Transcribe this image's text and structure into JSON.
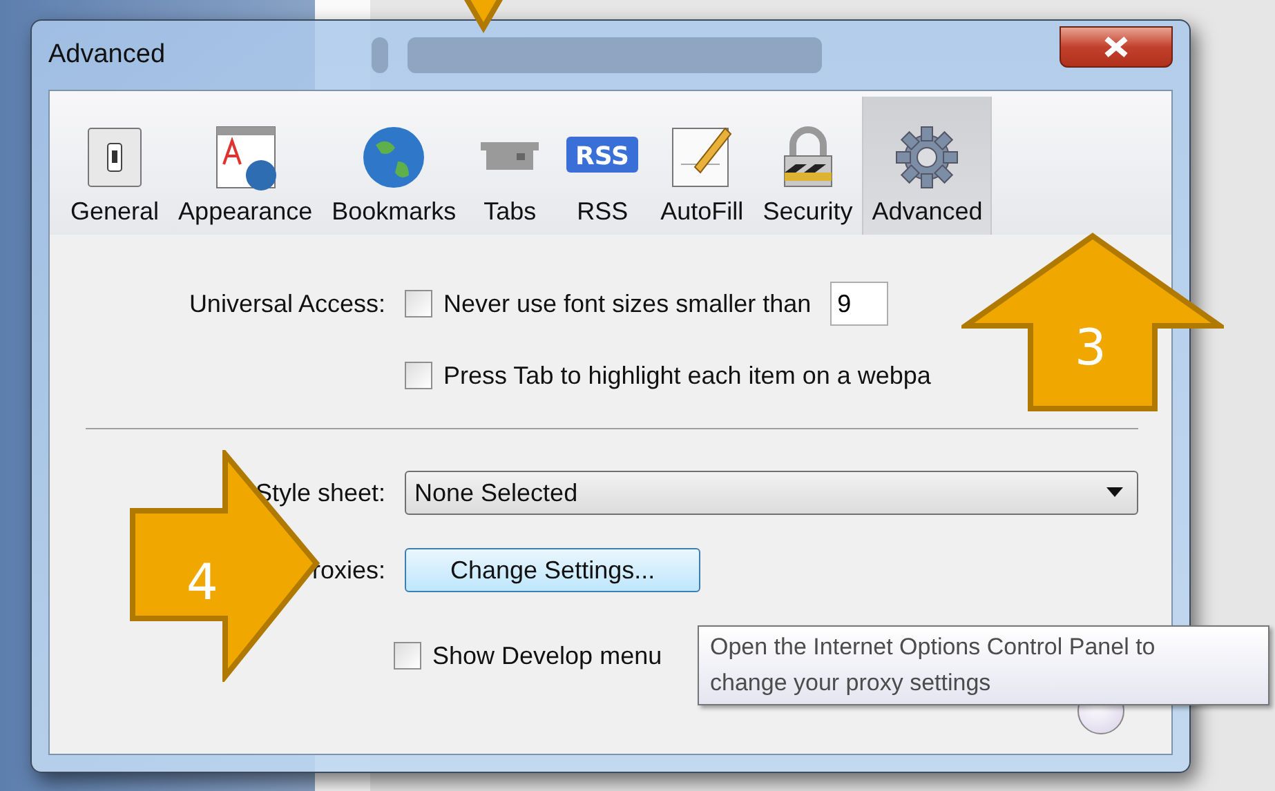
{
  "window": {
    "title": "Advanced"
  },
  "toolbar": [
    {
      "label": "General",
      "kind": "switch",
      "selected": false
    },
    {
      "label": "Appearance",
      "kind": "appearance",
      "selected": false
    },
    {
      "label": "Bookmarks",
      "kind": "globe",
      "selected": false
    },
    {
      "label": "Tabs",
      "kind": "tabs",
      "selected": false
    },
    {
      "label": "RSS",
      "kind": "rss",
      "icon_text": "RSS",
      "selected": false
    },
    {
      "label": "AutoFill",
      "kind": "autofill",
      "selected": false
    },
    {
      "label": "Security",
      "kind": "lock",
      "selected": false
    },
    {
      "label": "Advanced",
      "kind": "gear",
      "selected": true
    }
  ],
  "universal_access": {
    "label": "Universal Access:",
    "options": [
      {
        "label": "Never use font sizes smaller than",
        "checked": false,
        "value": "9"
      },
      {
        "label": "Press Tab to highlight each item on a webpa",
        "checked": false
      }
    ]
  },
  "style_sheet": {
    "label": "Style sheet:",
    "value": "None Selected"
  },
  "proxies": {
    "label": "roxies:",
    "button": "Change Settings..."
  },
  "develop": {
    "label": "Show Develop menu",
    "checked": false
  },
  "tooltip": {
    "lines": [
      "Open the Internet Options Control Panel to",
      "change your proxy settings"
    ]
  },
  "callouts": [
    {
      "kind": "down"
    },
    {
      "kind": "up",
      "label": "3"
    },
    {
      "kind": "right",
      "label": "4"
    }
  ]
}
